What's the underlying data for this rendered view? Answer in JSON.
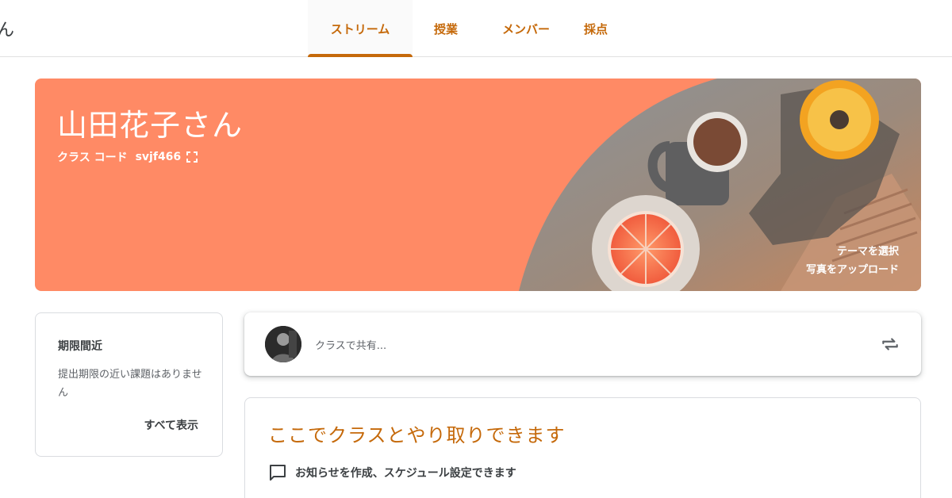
{
  "app": {
    "title_fragment": "ん"
  },
  "tabs": [
    {
      "label": "ストリーム",
      "active": true
    },
    {
      "label": "授業",
      "active": false
    },
    {
      "label": "メンバー",
      "active": false
    },
    {
      "label": "採点",
      "active": false
    }
  ],
  "banner": {
    "class_name": "山田花子さん",
    "code_label": "クラス コード",
    "code_value": "svjf466",
    "select_theme": "テーマを選択",
    "upload_photo": "写真をアップロード",
    "color": "#ff8a65"
  },
  "upcoming": {
    "title": "期限間近",
    "text": "提出期限の近い課題はありません",
    "view_all": "すべて表示"
  },
  "share": {
    "placeholder": "クラスで共有..."
  },
  "welcome": {
    "title": "ここでクラスとやり取りできます",
    "item": "お知らせを作成、スケジュール設定できます"
  },
  "colors": {
    "accent": "#c5690a",
    "banner": "#ff8a65"
  },
  "icons": [
    "fullscreen-icon",
    "repost-icon",
    "chat-icon"
  ]
}
